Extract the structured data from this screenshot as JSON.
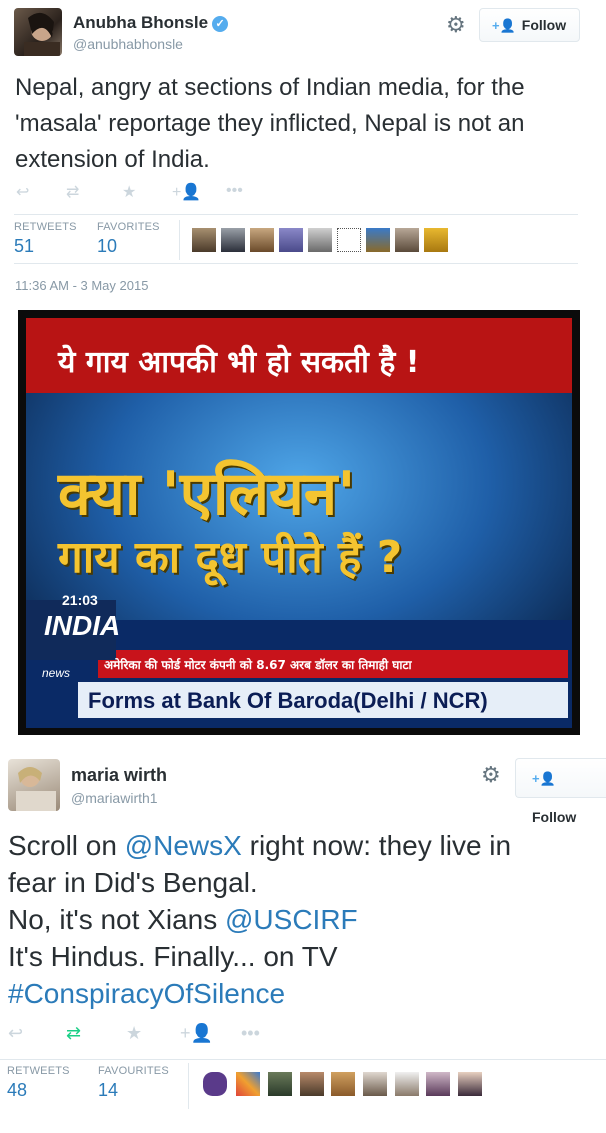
{
  "tweet1": {
    "name": "Anubha Bhonsle",
    "handle": "@anubhabhonsle",
    "follow_label": "Follow",
    "text": "Nepal, angry at sections of Indian media, for the 'masala' reportage they inflicted, Nepal is not an extension of India.",
    "retweets_label": "RETWEETS",
    "retweets": "51",
    "favorites_label": "FAVORITES",
    "favorites": "10",
    "timestamp": "11:36 AM - 3 May 2015",
    "media": {
      "line1": "ये गाय आपकी भी हो सकती है !",
      "line2": "क्या 'एलियन'",
      "line3": "गाय का दूध पीते हैं ?",
      "clock": "21:03",
      "channel": "INDIA",
      "channel_sub": "news",
      "ticker": "अमेरिका की फोर्ड मोटर कंपनी को 8.67 अरब डॉलर का तिमाही घाटा",
      "bottom": "Forms at Bank Of Baroda(Delhi / NCR)"
    }
  },
  "tweet2": {
    "name": "maria wirth",
    "handle": "@mariawirth1",
    "follow_label": "Follow",
    "text_lines": [
      {
        "before": "Scroll on ",
        "link": "@NewsX",
        "after": " right now: they live in"
      },
      {
        "before": "fear in Did's Bengal.",
        "link": "",
        "after": ""
      },
      {
        "before": "No, it's not Xians ",
        "link": "@USCIRF",
        "after": ""
      },
      {
        "before": "It's Hindus. Finally... on TV",
        "link": "",
        "after": ""
      },
      {
        "before": "",
        "link": "#ConspiracyOfSilence",
        "after": ""
      }
    ],
    "retweets_label": "RETWEETS",
    "retweets": "48",
    "favorites_label": "FAVOURITES",
    "favorites": "14"
  },
  "icons": {
    "reply": "reply-icon",
    "retweet": "retweet-icon",
    "favorite": "star-icon",
    "follow": "follow-user-icon",
    "more": "more-dots-icon",
    "settings": "gear-icon"
  },
  "colors": {
    "link": "#2b7bb9",
    "stat_value": "#2b7bb9",
    "retweeted": "#19cf86",
    "verified": "#55acee",
    "muted": "#8899a6"
  }
}
